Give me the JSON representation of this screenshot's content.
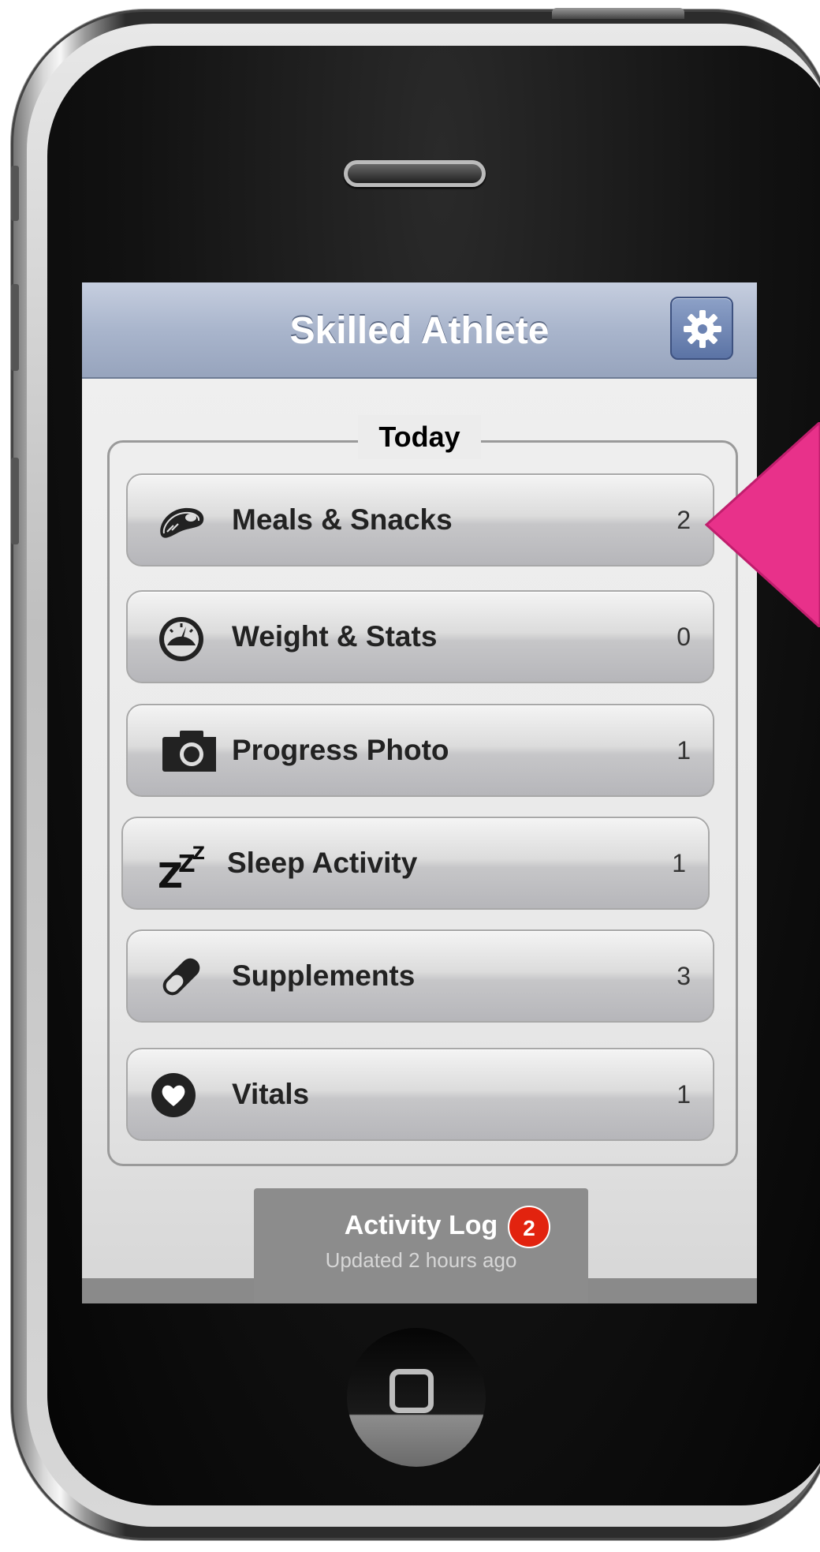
{
  "navbar": {
    "title": "Skilled Athlete"
  },
  "group": {
    "title": "Today"
  },
  "rows": [
    {
      "label": "Meals & Snacks",
      "count": "2",
      "icon": "steak-icon"
    },
    {
      "label": "Weight & Stats",
      "count": "0",
      "icon": "scale-gauge-icon"
    },
    {
      "label": "Progress Photo",
      "count": "1",
      "icon": "camera-icon"
    },
    {
      "label": "Sleep Activity",
      "count": "1",
      "icon": "zzz-sleep-icon"
    },
    {
      "label": "Supplements",
      "count": "3",
      "icon": "pill-icon"
    },
    {
      "label": "Vitals",
      "count": "1",
      "icon": "heart-icon"
    }
  ],
  "activity_log": {
    "title": "Activity Log",
    "subtitle": "Updated 2 hours ago",
    "badge": "2"
  },
  "colors": {
    "navbar": "#a9b5cc",
    "badge": "#e2230f",
    "pointer": "#e8318a"
  }
}
